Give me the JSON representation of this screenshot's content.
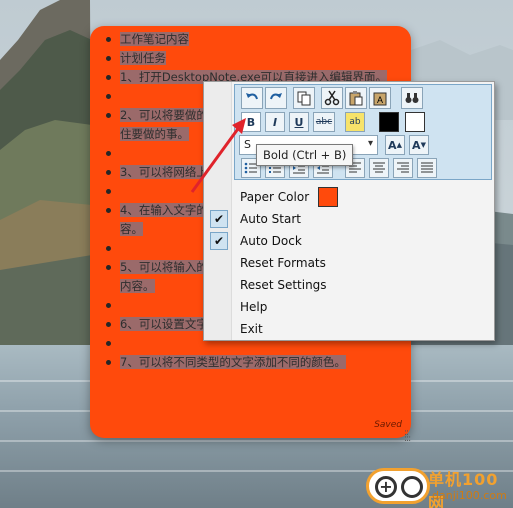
{
  "note": {
    "items": [
      "工作笔记内容",
      "计划任务",
      "1、打开DesktopNote.exe可以直接进入编辑界面。",
      "",
      "2、可以将要做的事情全部写到这里，方便可以随时候记住要做的事。",
      "",
      "3、可以将网络上的内容复制到这里保存。",
      "",
      "4、在输入文字的时候可以选择编辑的样式以及文字内容。",
      "",
      "5、可以将输入的内容设置为粗体、斜体，以及设置文字内容。",
      "",
      "6、可以设置文字颜色，例如小编设置红色。",
      "",
      "7、可以将不同类型的文字添加不同的颜色。"
    ],
    "status": "Saved",
    "background_color": "#ff4a0c"
  },
  "toolbar": {
    "row1": [
      "undo-icon",
      "redo-icon",
      "copy-icon",
      "cut-icon",
      "paste-icon",
      "paste-text-icon",
      "find-icon"
    ],
    "bold_label": "B",
    "italic_label": "I",
    "underline_label": "U",
    "strike_label": "abc",
    "highlight_label": "ab",
    "text_color": "#000000",
    "back_color": "#ffffff",
    "font_select_value": "S",
    "font_select_arrow": "▾",
    "grow_font_label": "A",
    "shrink_font_label": "A",
    "row3": [
      "bullet-list-icon",
      "numbered-list-icon",
      "indent-icon",
      "outdent-icon",
      "align-left-icon",
      "align-center-icon",
      "align-right-icon",
      "justify-icon"
    ]
  },
  "tooltip": "Bold (Ctrl + B)",
  "menu": {
    "items": [
      {
        "label": "Paper Color",
        "checked": false,
        "color": "#ff4a0c"
      },
      {
        "label": "Auto Start",
        "checked": true
      },
      {
        "label": "Auto Dock",
        "checked": true
      },
      {
        "label": "Reset Formats",
        "checked": false
      },
      {
        "label": "Reset Settings",
        "checked": false
      },
      {
        "label": "Help",
        "checked": false
      },
      {
        "label": "Exit",
        "checked": false
      }
    ],
    "check_mark": "✔"
  },
  "watermark": {
    "site_name": "单机100网",
    "site_url": "danji100.com"
  },
  "colors": {
    "accent": "#ff4a0c",
    "toolbar_bg": "#cfe3f1",
    "arrow": "#e0232b"
  }
}
